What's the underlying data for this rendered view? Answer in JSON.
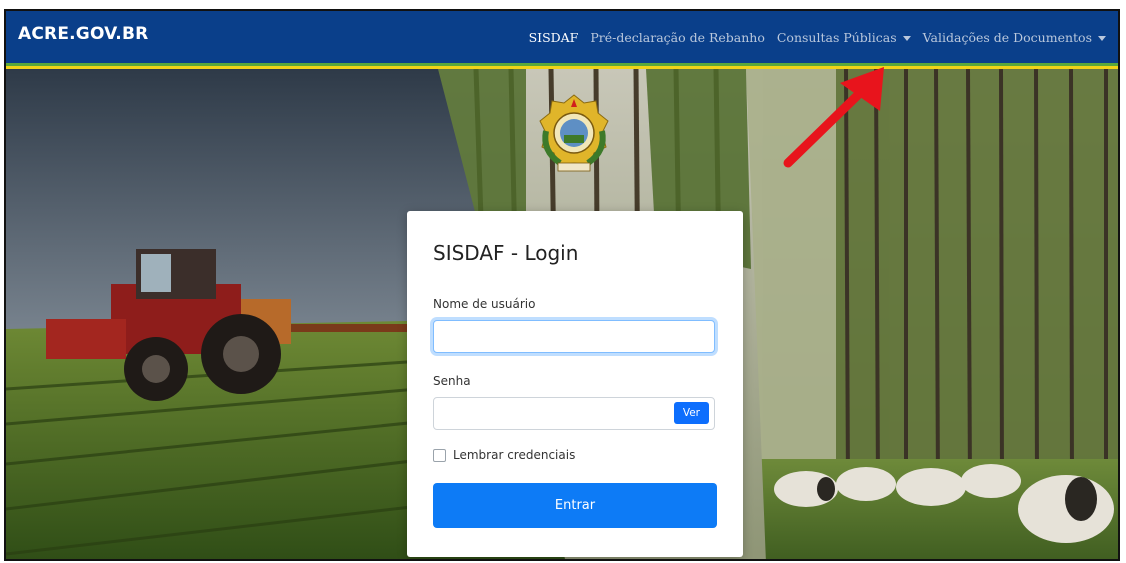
{
  "navbar": {
    "brand": "ACRE.GOV.BR",
    "links": [
      {
        "label": "SISDAF",
        "active": true,
        "dropdown": false
      },
      {
        "label": "Pré-declaração de Rebanho",
        "active": false,
        "dropdown": false
      },
      {
        "label": "Consultas Públicas",
        "active": false,
        "dropdown": true
      },
      {
        "label": "Validações de Documentos",
        "active": false,
        "dropdown": true
      }
    ]
  },
  "login": {
    "title": "SISDAF - Login",
    "username_label": "Nome de usuário",
    "username_value": "",
    "password_label": "Senha",
    "password_value": "",
    "show_password_button": "Ver",
    "remember_label": "Lembrar credenciais",
    "remember_checked": false,
    "submit_label": "Entrar"
  },
  "colors": {
    "navbar_bg": "#0a3f8a",
    "stripe_green": "#5aa83a",
    "stripe_yellow": "#f0d318",
    "primary_button": "#0d7bf6",
    "annotation_arrow": "#e8141c"
  },
  "icons": {
    "emblem": "acre-state-coat-of-arms-icon",
    "annotation": "red-arrow-icon",
    "dropdown": "caret-down-icon"
  }
}
